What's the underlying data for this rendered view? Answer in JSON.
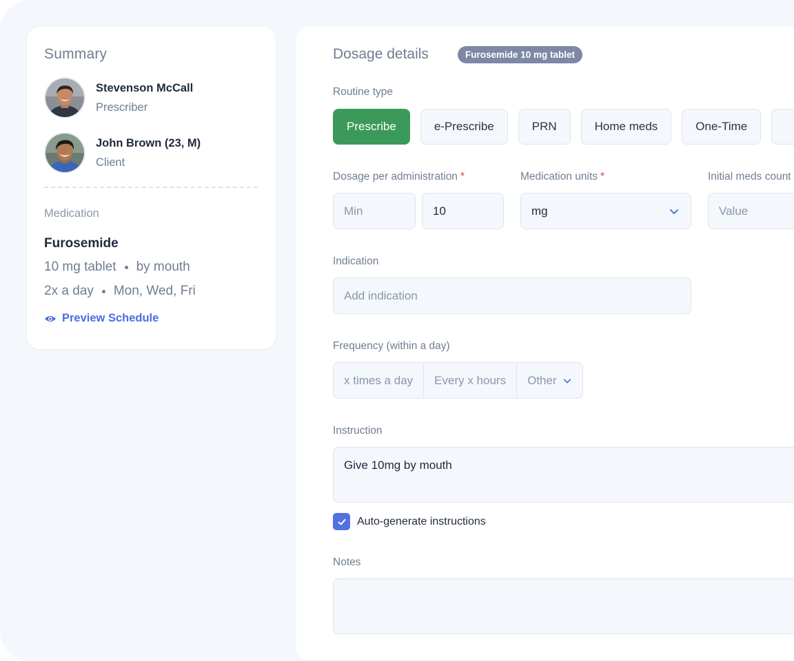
{
  "summary": {
    "title": "Summary",
    "prescriber": {
      "name": "Stevenson McCall",
      "role": "Prescriber"
    },
    "client": {
      "name": "John Brown (23, M)",
      "role": "Client"
    },
    "medication_label": "Medication",
    "medication_name": "Furosemide",
    "dose": "10 mg tablet",
    "route": "by mouth",
    "frequency": "2x a day",
    "days": "Mon, Wed, Fri",
    "preview_link": "Preview Schedule"
  },
  "dosage": {
    "title": "Dosage details",
    "badge": "Furosemide 10 mg tablet",
    "routine_label": "Routine type",
    "routine_types": [
      "Prescribe",
      "e-Prescribe",
      "PRN",
      "Home meds",
      "One-Time"
    ],
    "active_routine": "Prescribe",
    "dosage_label": "Dosage per administration",
    "dosage_min_placeholder": "Min",
    "dosage_value": "10",
    "units_label": "Medication units",
    "units_value": "mg",
    "initial_count_label": "Initial meds count",
    "initial_count_placeholder": "Value",
    "required_mark": "*",
    "indication_label": "Indication",
    "indication_placeholder": "Add indication",
    "frequency_label": "Frequency (within a day)",
    "frequency_options": [
      "x times a day",
      "Every x hours",
      "Other"
    ],
    "instruction_label": "Instruction",
    "instruction_value": "Give 10mg by mouth",
    "auto_generate_label": "Auto-generate instructions",
    "auto_generate_checked": true,
    "notes_label": "Notes"
  },
  "colors": {
    "accent_green": "#3b9a59",
    "link_blue": "#4a6de0",
    "badge_gray": "#7c88a4",
    "required_red": "#d9483b"
  }
}
